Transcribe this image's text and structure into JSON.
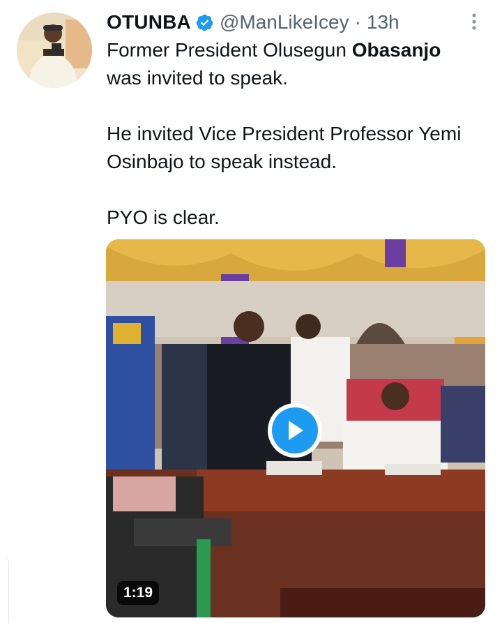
{
  "tweet": {
    "display_name": "OTUNBA",
    "handle": "@ManLikeIcey",
    "separator": "·",
    "time": "13h",
    "verified": true,
    "verified_color": "#1d9bf0",
    "text_line1_prefix": "Former President Olusegun ",
    "text_line1_bold": "Obasanjo",
    "text_line2": "was invited to speak.",
    "paragraph2": "He invited Vice President Professor Yemi Osinbajo to speak instead.",
    "paragraph3": "PYO is clear."
  },
  "icons": {
    "more": "more-vertical-icon",
    "verified": "verified-badge-icon",
    "play": "play-icon"
  },
  "media": {
    "type": "video",
    "duration": "1:19",
    "accent_color": "#1d9bf0"
  }
}
